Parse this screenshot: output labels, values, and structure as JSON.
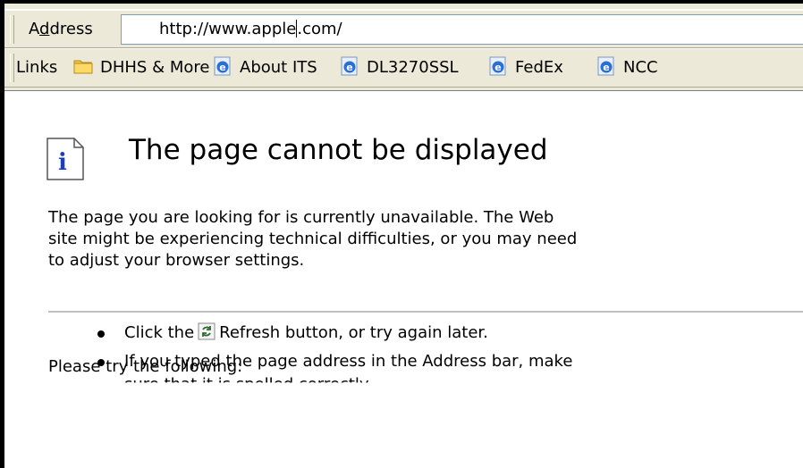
{
  "address_bar": {
    "label": "Address",
    "url_before_caret": "http://www.apple",
    "url_after_caret": ".com/"
  },
  "links_bar": {
    "label": "Links",
    "items": [
      {
        "label": "DHHS & More",
        "icon": "folder-icon"
      },
      {
        "label": "About ITS",
        "icon": "ie-page-icon"
      },
      {
        "label": "DL3270SSL",
        "icon": "ie-page-icon"
      },
      {
        "label": "FedEx",
        "icon": "ie-page-icon"
      },
      {
        "label": "NCC",
        "icon": "ie-page-icon"
      }
    ]
  },
  "page": {
    "title": "The page cannot be displayed",
    "description_lines": [
      "The page you are looking for is currently unavailable. The Web",
      "site might be experiencing technical difficulties, or you may need",
      "to adjust your browser settings."
    ],
    "try_heading": "Please try the following:",
    "bullets": {
      "refresh_before": "Click the",
      "refresh_after": "Refresh button, or try again later.",
      "typed": "If you typed the page address in the Address bar, make",
      "typed_cont": "sure that it is spelled correctly."
    }
  }
}
